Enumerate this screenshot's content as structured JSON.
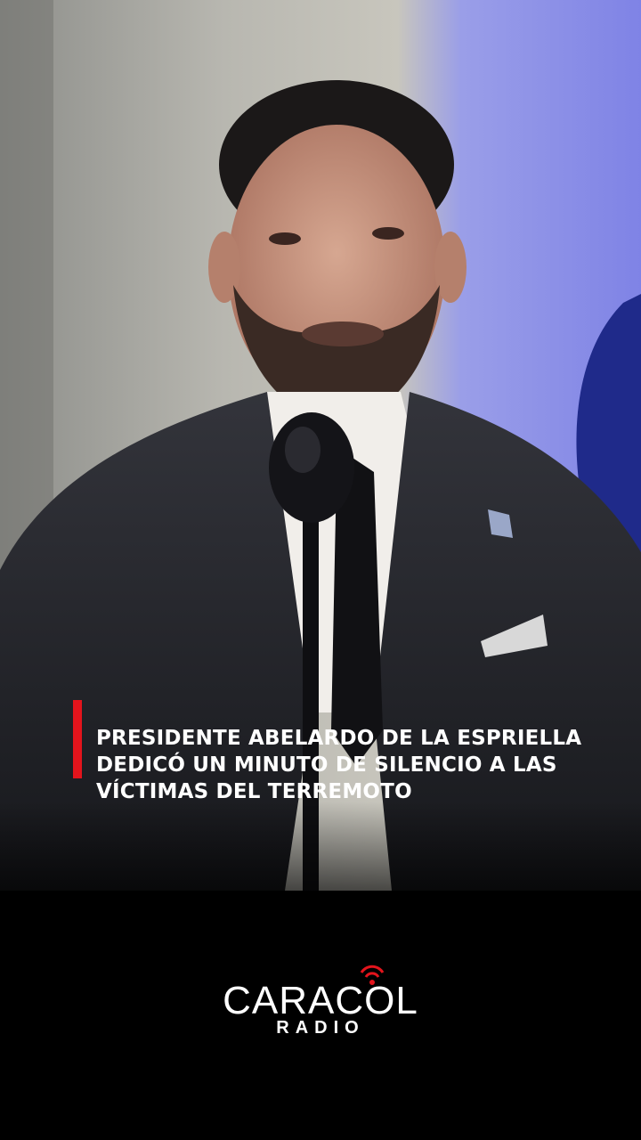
{
  "video": {
    "headline": "PRESIDENTE ABELARDO DE LA ESPRIELLA DEDICÓ UN MINUTO DE SILENCIO A LAS VÍCTIMAS DEL TERREMOTO",
    "accent_color": "#e3141c"
  },
  "brand": {
    "logo_text": "CARACOL",
    "logo_sub": "RADIO",
    "logo_icon": "broadcast-signal-icon"
  }
}
